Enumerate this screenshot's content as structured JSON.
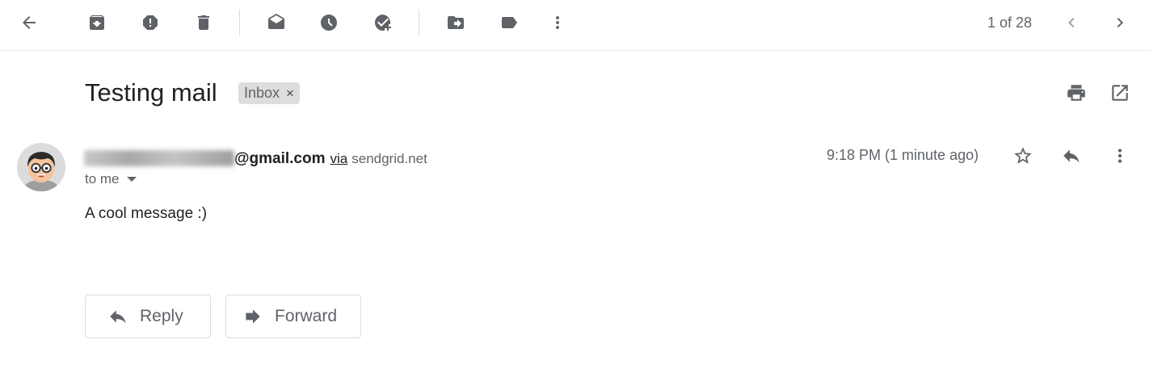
{
  "toolbar": {
    "icons": [
      "back-arrow-icon",
      "archive-icon",
      "report-spam-icon",
      "delete-icon",
      "mark-unread-icon",
      "snooze-icon",
      "add-to-tasks-icon",
      "move-to-icon",
      "labels-icon",
      "more-vert-icon"
    ],
    "pager": "1 of 28"
  },
  "email": {
    "subject": "Testing mail",
    "label": "Inbox",
    "label_remove": "×",
    "sender_email": "@gmail.com",
    "via": "via",
    "via_domain": "sendgrid.net",
    "to": "to me",
    "timestamp": "9:18 PM (1 minute ago)",
    "body": "A cool message :)"
  },
  "actions": {
    "reply_label": "Reply",
    "forward_label": "Forward"
  },
  "colors": {
    "icon": "#5f6368",
    "label_bg": "#dddddd",
    "divider": "#e8eaed"
  }
}
